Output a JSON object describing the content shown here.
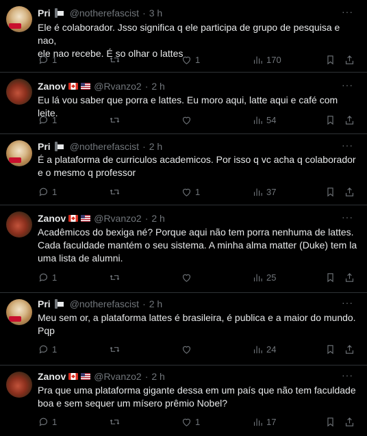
{
  "tweets": [
    {
      "name": "Pri",
      "handle": "@notherefascist",
      "time": "3 h",
      "text": "Ele é colaborador. Jsso significa q ele participa de grupo de pesquisa e nao,\nele nao recebe. É so olhar o lattes",
      "replies": "1",
      "retweets": "",
      "likes": "1",
      "views": "170"
    },
    {
      "name": "Zanov",
      "handle": "@Rvanzo2",
      "time": "2 h",
      "text": "Eu lá vou saber que porra e lattes. Eu moro aqui, latte aqui e café com leite.",
      "replies": "1",
      "retweets": "",
      "likes": "",
      "views": "54"
    },
    {
      "name": "Pri",
      "handle": "@notherefascist",
      "time": "2 h",
      "text": "É a plataforma de curriculos academicos. Por isso q vc acha q colaborador\ne o mesmo q professor",
      "replies": "1",
      "retweets": "",
      "likes": "1",
      "views": "37"
    },
    {
      "name": "Zanov",
      "handle": "@Rvanzo2",
      "time": "2 h",
      "text": "Acadêmicos do bexiga né? Porque aqui não tem porra nenhuma de lattes.\nCada faculdade mantém o seu sistema. A minha alma matter (Duke) tem la\numa lista de alumni.",
      "replies": "1",
      "retweets": "",
      "likes": "",
      "views": "25"
    },
    {
      "name": "Pri",
      "handle": "@notherefascist",
      "time": "2 h",
      "text": "Meu sem or, a plataforma lattes é brasileira, é publica e a maior do mundo.\nPqp",
      "replies": "1",
      "retweets": "",
      "likes": "",
      "views": "24"
    },
    {
      "name": "Zanov",
      "handle": "@Rvanzo2",
      "time": "2 h",
      "text": "Pra que uma plataforma gigante dessa em um país que não tem faculdade\nboa e sem sequer um mísero prêmio Nobel?",
      "replies": "1",
      "retweets": "",
      "likes": "1",
      "views": "17"
    }
  ],
  "more_label": "···",
  "time_sep": "·"
}
